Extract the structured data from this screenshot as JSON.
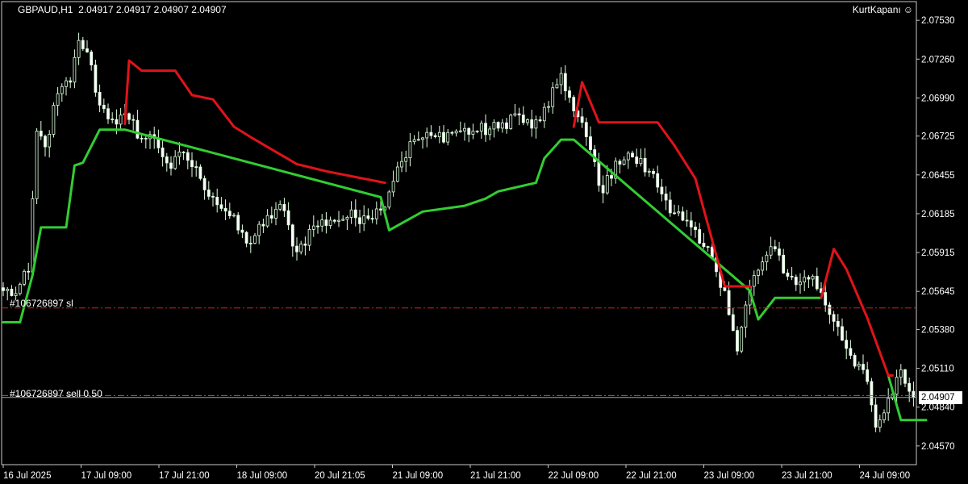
{
  "header": {
    "symbol": "GBPAUD,H1",
    "ohlc": "2.04917 2.04917 2.04907 2.04907"
  },
  "expert": {
    "name": "KurtKapanı",
    "icon": "smiley-icon"
  },
  "orders": {
    "sl_label": "#106726897 sl",
    "sell_label": "#106726897 sell 0.50"
  },
  "price_axis": {
    "current_price": "2.04907"
  },
  "colors": {
    "background": "#000000",
    "bull_fill": "#000000",
    "bear_fill": "#ffffff",
    "candle_outline": "#dfffdf",
    "trend_up": "#32cd32",
    "trend_down": "#e0131a",
    "sl_line": "#d42020",
    "entry_line": "#3c9a3c"
  },
  "chart_data": {
    "type": "candlestick",
    "symbol": "GBPAUD",
    "timeframe": "H1",
    "ylim": [
      2.0444,
      2.0766
    ],
    "y_ticks": [
      2.0753,
      2.0726,
      2.0699,
      2.06725,
      2.06455,
      2.06185,
      2.05915,
      2.05645,
      2.0538,
      2.0511,
      2.0484,
      2.0457
    ],
    "y_tick_labels": [
      "2.07530",
      "2.07260",
      "2.06990",
      "2.06725",
      "2.06455",
      "2.06185",
      "2.05915",
      "2.05645",
      "2.05380",
      "2.05110",
      "2.04840",
      "2.04570"
    ],
    "x_tick_labels": [
      "16 Jul 2025",
      "17 Jul 09:00",
      "17 Jul 21:00",
      "18 Jul 09:00",
      "20 Jul 21:05",
      "21 Jul 09:00",
      "21 Jul 21:00",
      "22 Jul 09:00",
      "22 Jul 21:00",
      "23 Jul 09:00",
      "23 Jul 21:00",
      "24 Jul 09:00"
    ],
    "sl_price": 2.0553,
    "entry_price": 2.0492,
    "current_price": 2.04907,
    "series": [
      {
        "kind": "candles",
        "anchors": [
          [
            0,
            2.0565
          ],
          [
            3,
            2.0563
          ],
          [
            6,
            2.0578
          ],
          [
            8,
            2.0676
          ],
          [
            10,
            2.0665
          ],
          [
            13,
            2.0702
          ],
          [
            16,
            2.071
          ],
          [
            18,
            2.0739
          ],
          [
            20,
            2.0731
          ],
          [
            23,
            2.0694
          ],
          [
            26,
            2.0684
          ],
          [
            30,
            2.0684
          ],
          [
            33,
            2.0671
          ],
          [
            36,
            2.0671
          ],
          [
            40,
            2.065
          ],
          [
            43,
            2.0661
          ],
          [
            47,
            2.0643
          ],
          [
            50,
            2.063
          ],
          [
            54,
            2.0617
          ],
          [
            58,
            2.0598
          ],
          [
            62,
            2.061
          ],
          [
            66,
            2.0625
          ],
          [
            70,
            2.0592
          ],
          [
            74,
            2.061
          ],
          [
            78,
            2.0614
          ],
          [
            82,
            2.0616
          ],
          [
            86,
            2.0617
          ],
          [
            90,
            2.0621
          ],
          [
            94,
            2.0651
          ],
          [
            98,
            2.067
          ],
          [
            103,
            2.0672
          ],
          [
            108,
            2.0676
          ],
          [
            113,
            2.0676
          ],
          [
            118,
            2.0678
          ],
          [
            122,
            2.0688
          ],
          [
            126,
            2.0678
          ],
          [
            130,
            2.0693
          ],
          [
            133,
            2.0716
          ],
          [
            136,
            2.069
          ],
          [
            139,
            2.0672
          ],
          [
            143,
            2.0633
          ],
          [
            146,
            2.0655
          ],
          [
            150,
            2.0658
          ],
          [
            154,
            2.0648
          ],
          [
            158,
            2.0628
          ],
          [
            162,
            2.0614
          ],
          [
            166,
            2.0598
          ],
          [
            169,
            2.0588
          ],
          [
            172,
            2.0565
          ],
          [
            175,
            2.0523
          ],
          [
            178,
            2.0568
          ],
          [
            181,
            2.0585
          ],
          [
            184,
            2.0594
          ],
          [
            187,
            2.0575
          ],
          [
            190,
            2.0571
          ],
          [
            193,
            2.0575
          ],
          [
            196,
            2.0555
          ],
          [
            199,
            2.054
          ],
          [
            202,
            2.052
          ],
          [
            205,
            2.051
          ],
          [
            208,
            2.047
          ],
          [
            210,
            2.048
          ],
          [
            212,
            2.0493
          ],
          [
            214,
            2.051
          ],
          [
            216,
            2.0495
          ],
          [
            217,
            2.04907
          ]
        ]
      },
      {
        "kind": "trend_line",
        "name": "",
        "color": "trend_up",
        "points": [
          [
            0,
            2.0543
          ],
          [
            4,
            2.0543
          ],
          [
            7,
            2.0576
          ],
          [
            9,
            2.0609
          ],
          [
            15,
            2.0609
          ],
          [
            17,
            2.0652
          ],
          [
            19,
            2.0654
          ],
          [
            23,
            2.0677
          ],
          [
            29,
            2.0677
          ],
          [
            90,
            2.063
          ],
          [
            92,
            2.0607
          ],
          [
            100,
            2.062
          ],
          [
            110,
            2.0624
          ],
          [
            115,
            2.0629
          ],
          [
            118,
            2.0634
          ],
          [
            127,
            2.064
          ],
          [
            129,
            2.0657
          ],
          [
            133,
            2.067
          ],
          [
            136,
            2.067
          ],
          [
            178,
            2.0565
          ],
          [
            180,
            2.0545
          ],
          [
            184,
            2.056
          ],
          [
            195,
            2.056
          ]
        ]
      },
      {
        "kind": "trend_line",
        "name": "",
        "color": "trend_up",
        "points": [
          [
            211,
            2.0506
          ],
          [
            214,
            2.0475
          ],
          [
            220,
            2.0475
          ]
        ]
      },
      {
        "kind": "trend_line",
        "name": "",
        "color": "trend_down",
        "points": [
          [
            29,
            2.0681
          ],
          [
            30,
            2.0725
          ],
          [
            33,
            2.0718
          ],
          [
            41,
            2.0718
          ],
          [
            45,
            2.0701
          ],
          [
            50,
            2.0698
          ],
          [
            55,
            2.0679
          ],
          [
            60,
            2.067
          ],
          [
            70,
            2.0653
          ],
          [
            77,
            2.0648
          ],
          [
            91,
            2.064
          ]
        ]
      },
      {
        "kind": "trend_line",
        "name": "",
        "color": "trend_down",
        "points": [
          [
            136,
            2.0679
          ],
          [
            138,
            2.071
          ],
          [
            142,
            2.0682
          ],
          [
            156,
            2.0682
          ],
          [
            160,
            2.0666
          ],
          [
            165,
            2.0643
          ],
          [
            172,
            2.0568
          ],
          [
            178,
            2.0568
          ]
        ]
      },
      {
        "kind": "trend_line",
        "name": "",
        "color": "trend_down",
        "points": [
          [
            195,
            2.056
          ],
          [
            198,
            2.0594
          ],
          [
            201,
            2.058
          ],
          [
            206,
            2.0546
          ],
          [
            211,
            2.0506
          ],
          [
            212,
            2.0506
          ]
        ]
      }
    ]
  }
}
